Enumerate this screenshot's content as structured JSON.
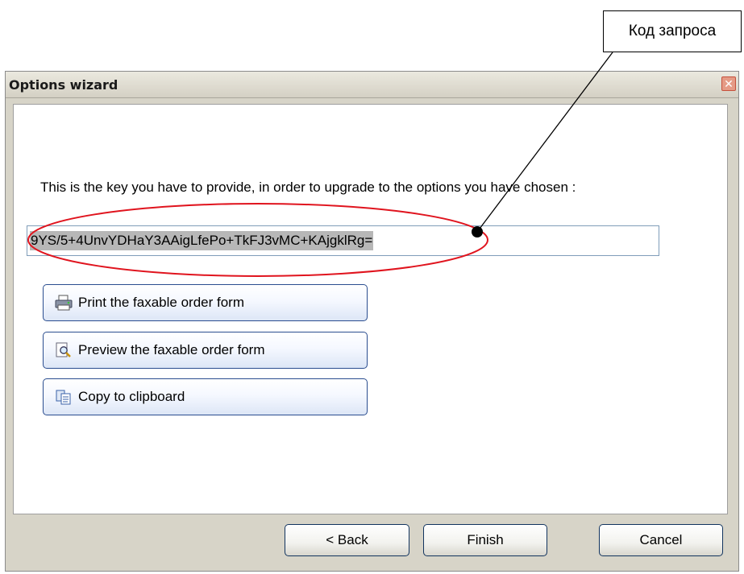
{
  "callout": {
    "label": "Код запроса"
  },
  "window": {
    "title": "Options wizard",
    "close_glyph": "✕"
  },
  "content": {
    "instruction": "This is the key you have to provide, in order to upgrade to the options you have chosen :",
    "key_value": "9YS/5+4UnvYDHaY3AAigLfePo+TkFJ3vMC+KAjgklRg="
  },
  "actions": [
    {
      "label": "Print the faxable order form",
      "icon": "printer-icon"
    },
    {
      "label": "Preview the faxable order form",
      "icon": "preview-icon"
    },
    {
      "label": "Copy to clipboard",
      "icon": "clipboard-icon"
    }
  ],
  "footer": {
    "back_label": "< Back",
    "finish_label": "Finish",
    "cancel_label": "Cancel"
  },
  "colors": {
    "highlight_ellipse": "#e0141e",
    "callout_line": "#000000",
    "button_border": "#2a4d8f"
  }
}
